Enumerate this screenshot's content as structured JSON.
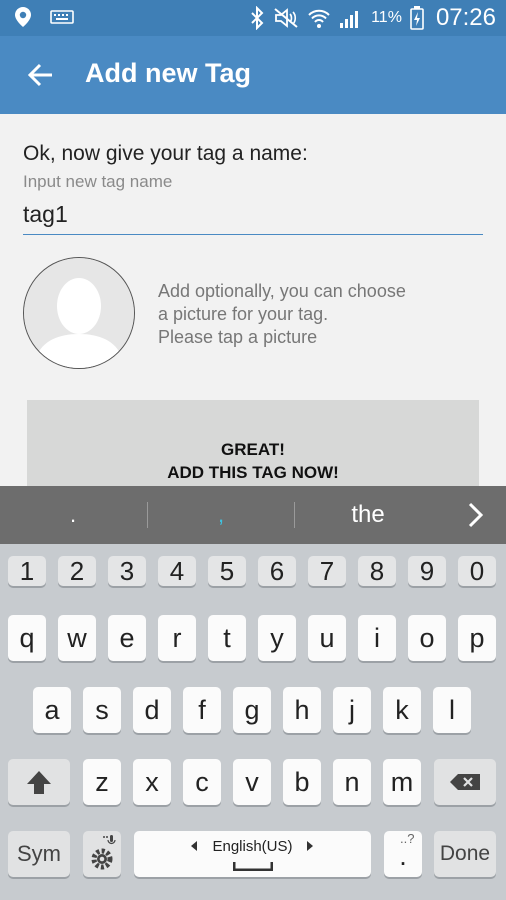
{
  "status_bar": {
    "battery_percent": "11%",
    "clock": "07:26"
  },
  "app_bar": {
    "title": "Add new Tag"
  },
  "form": {
    "prompt": "Ok, now give your tag a name:",
    "input_hint": "Input new tag name",
    "input_value": "tag1",
    "picture_text": [
      "Add optionally, you can choose",
      "a picture for your tag.",
      "Please tap a picture"
    ],
    "add_button_lines": [
      "GREAT!",
      "ADD THIS TAG NOW!"
    ]
  },
  "keyboard": {
    "suggestions": [
      ".",
      ",",
      "the"
    ],
    "number_row": [
      "1",
      "2",
      "3",
      "4",
      "5",
      "6",
      "7",
      "8",
      "9",
      "0"
    ],
    "row1": [
      "q",
      "w",
      "e",
      "r",
      "t",
      "y",
      "u",
      "i",
      "o",
      "p"
    ],
    "row2": [
      "a",
      "s",
      "d",
      "f",
      "g",
      "h",
      "j",
      "k",
      "l"
    ],
    "row3": [
      "z",
      "x",
      "c",
      "v",
      "b",
      "n",
      "m"
    ],
    "sym_label": "Sym",
    "language_label": "English(US)",
    "done_label": "Done",
    "period_label": "."
  }
}
